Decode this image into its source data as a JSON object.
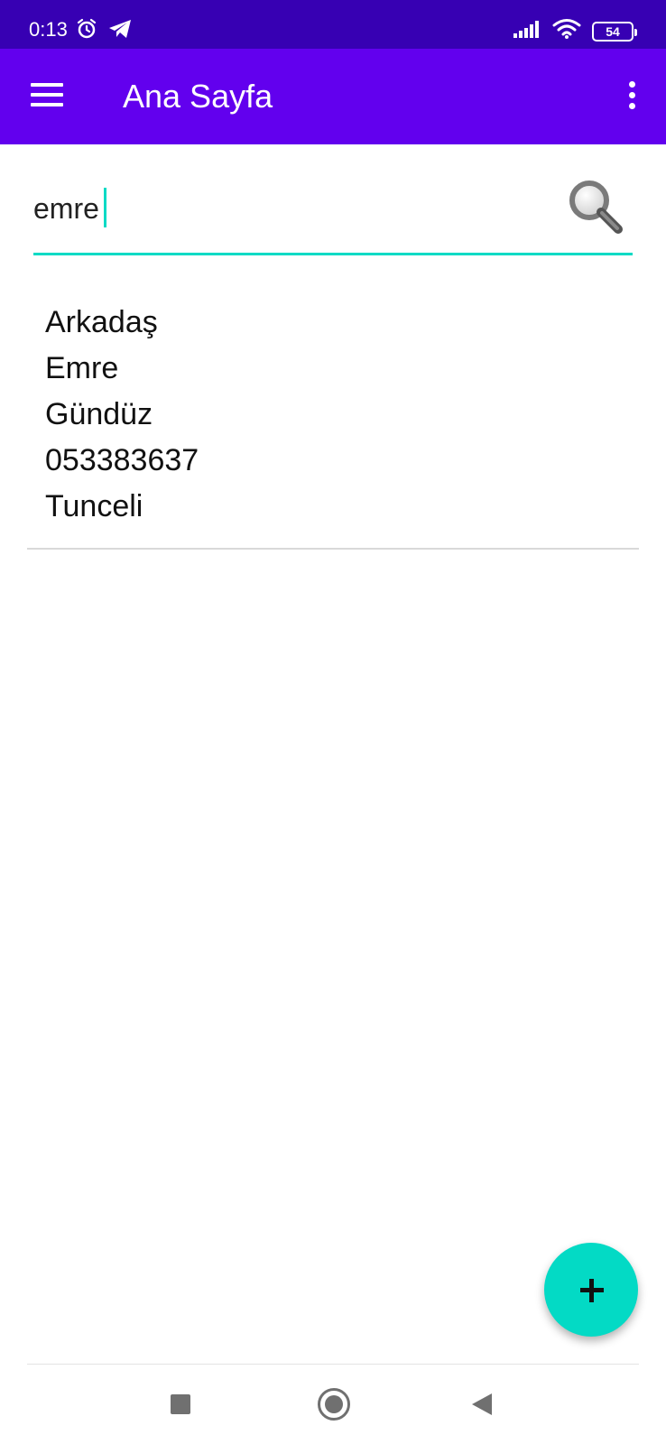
{
  "status_bar": {
    "time": "0:13",
    "battery_level": "54",
    "left_icons": [
      "alarm-icon",
      "telegram-icon"
    ],
    "right_icons": [
      "signal-icon",
      "wifi-icon",
      "battery-icon"
    ]
  },
  "app_bar": {
    "title": "Ana Sayfa",
    "menu_icon": "hamburger-menu-icon",
    "overflow_icon": "more-vertical-icon"
  },
  "search": {
    "value": "emre",
    "icon": "search-icon"
  },
  "contact": {
    "lines": [
      "Arkadaş",
      "Emre",
      "Gündüz",
      "053383637",
      "Tunceli"
    ]
  },
  "fab": {
    "icon": "add-icon"
  },
  "nav_bar": {
    "icons": [
      "recent-apps-icon",
      "home-icon",
      "back-icon"
    ]
  },
  "colors": {
    "status_bar": "#3700b3",
    "app_bar": "#6200ee",
    "accent": "#03dac5",
    "nav_icons": "#707070"
  }
}
